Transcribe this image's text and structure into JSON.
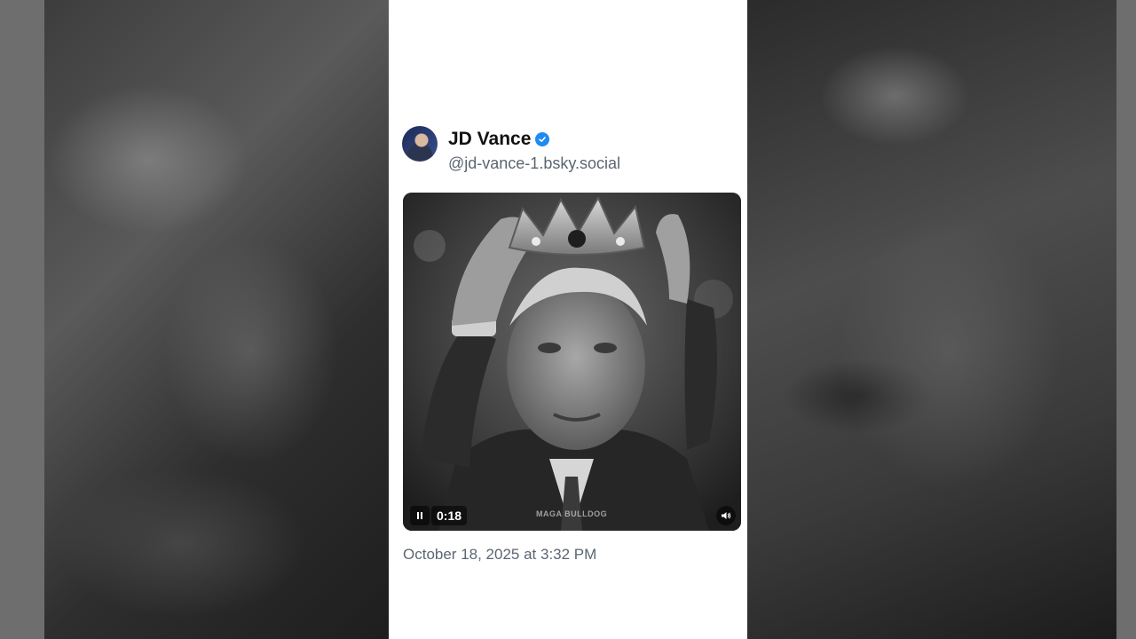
{
  "post": {
    "author": {
      "display_name": "JD Vance",
      "handle": "@jd-vance-1.bsky.social",
      "verified": true,
      "avatar_icon": "profile-photo"
    },
    "video": {
      "elapsed": "0:18",
      "state": "playing",
      "watermark": "MAGA BULLDOG",
      "controls": {
        "play_pause_icon": "pause-icon",
        "volume_icon": "speaker-icon"
      }
    },
    "timestamp": "October 18, 2025 at 3:32 PM"
  },
  "colors": {
    "card_background": "#ffffff",
    "verified_badge": "#1d8cf0",
    "name_text": "#111111",
    "secondary_text": "#5b6672",
    "backdrop": "#2a2a2a"
  }
}
